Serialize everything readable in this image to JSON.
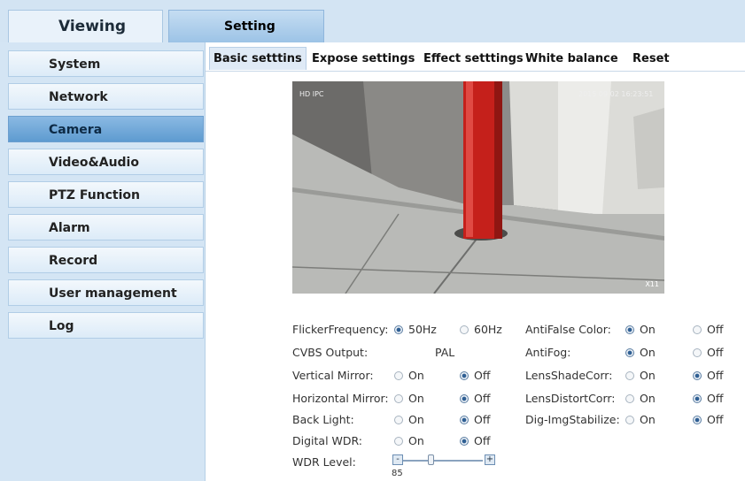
{
  "top_tabs": {
    "viewing": "Viewing",
    "setting": "Setting"
  },
  "sidebar": {
    "items": [
      {
        "label": "System"
      },
      {
        "label": "Network"
      },
      {
        "label": "Camera",
        "active": true
      },
      {
        "label": "Video&Audio"
      },
      {
        "label": "PTZ Function"
      },
      {
        "label": "Alarm"
      },
      {
        "label": "Record"
      },
      {
        "label": "User management"
      },
      {
        "label": "Log"
      }
    ]
  },
  "subtabs": [
    {
      "label": "Basic setttins",
      "active": true
    },
    {
      "label": "Expose settings"
    },
    {
      "label": "Effect setttings"
    },
    {
      "label": "White balance"
    },
    {
      "label": "Reset"
    }
  ],
  "video": {
    "osd_name": "HD IPC",
    "osd_datetime": "2015 09 02 16:23:51",
    "zoom": "X11"
  },
  "settings_left": {
    "flicker": {
      "label": "FlickerFrequency:",
      "opt1": "50Hz",
      "opt2": "60Hz",
      "selected": "50Hz"
    },
    "cvbs": {
      "label": "CVBS Output:",
      "value": "PAL"
    },
    "vmirror": {
      "label": "Vertical Mirror:",
      "on": "On",
      "off": "Off",
      "selected": "Off"
    },
    "hmirror": {
      "label": "Horizontal Mirror:",
      "on": "On",
      "off": "Off",
      "selected": "Off"
    },
    "backlight": {
      "label": "Back Light:",
      "on": "On",
      "off": "Off",
      "selected": "Off"
    },
    "dwdr": {
      "label": "Digital WDR:",
      "on": "On",
      "off": "Off",
      "selected": "Off"
    },
    "wdr_level": {
      "label": "WDR Level:",
      "value": "85",
      "minus": "-",
      "plus": "+",
      "level_fraction": 0.4
    }
  },
  "settings_right": {
    "antifalse": {
      "label": "AntiFalse Color:",
      "on": "On",
      "off": "Off",
      "selected": "On"
    },
    "antifog": {
      "label": "AntiFog:",
      "on": "On",
      "off": "Off",
      "selected": "On"
    },
    "lensshade": {
      "label": "LensShadeCorr:",
      "on": "On",
      "off": "Off",
      "selected": "Off"
    },
    "lensdistort": {
      "label": "LensDistortCorr:",
      "on": "On",
      "off": "Off",
      "selected": "Off"
    },
    "digimg": {
      "label": "Dig-ImgStabilize:",
      "on": "On",
      "off": "Off",
      "selected": "Off"
    }
  }
}
